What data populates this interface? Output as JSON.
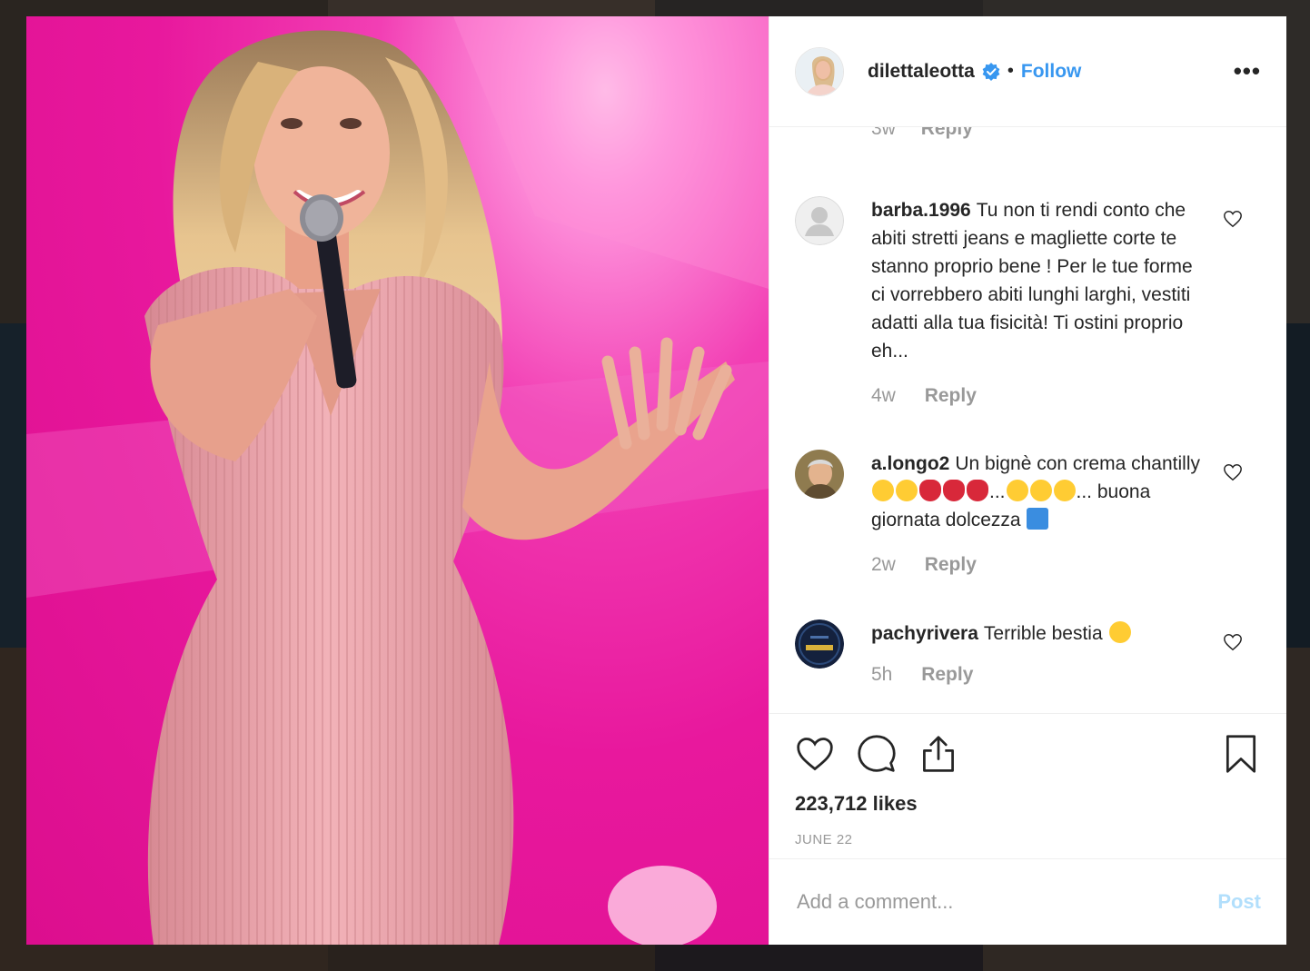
{
  "post": {
    "username": "dilettaleotta",
    "follow_label": "Follow",
    "separator": "•",
    "more_label": "•••"
  },
  "comments_cut": {
    "time": "3w",
    "reply_label": "Reply"
  },
  "comments": [
    {
      "username": "barba.1996",
      "text": "Tu non ti rendi conto che abiti stretti jeans e magliette corte te stanno proprio bene ! Per le tue forme ci vorrebbero abiti lunghi larghi, vestiti adatti alla tua fisicità! Ti ostini proprio eh...",
      "time": "4w",
      "reply_label": "Reply"
    },
    {
      "username": "a.longo2",
      "text_a": "Un bignè con crema chantilly",
      "text_b": "...",
      "text_c": "...",
      "text_d": "buona giornata dolcezza",
      "time": "2w",
      "reply_label": "Reply"
    },
    {
      "username": "pachyrivera",
      "text": "Terrible bestia",
      "time": "5h",
      "reply_label": "Reply"
    }
  ],
  "likes": "223,712 likes",
  "date": "JUNE 22",
  "add_comment": {
    "placeholder": "Add a comment...",
    "post_label": "Post"
  },
  "colors": {
    "link": "#3897f0",
    "photo_bg": "#e8189d",
    "post_disabled": "#b2dffc"
  }
}
